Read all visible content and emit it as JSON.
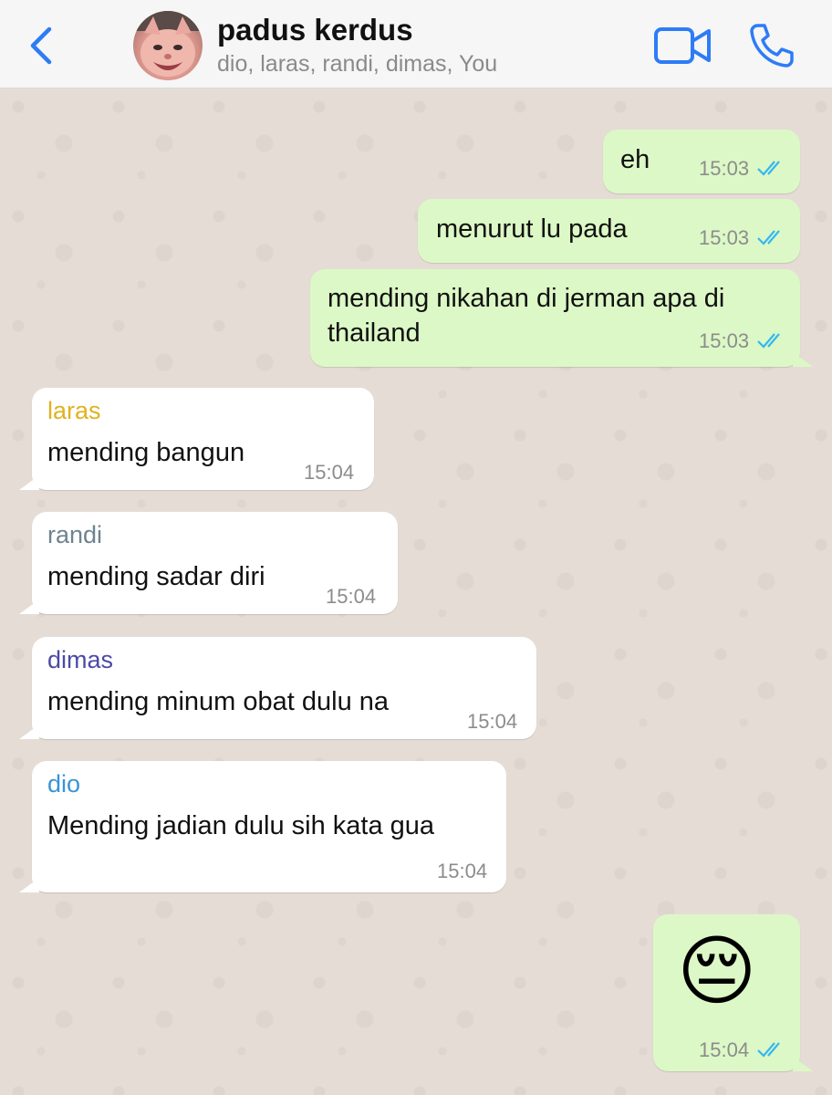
{
  "header": {
    "group_name": "padus kerdus",
    "members": "dio, laras, randi, dimas, You"
  },
  "colors": {
    "accent": "#2d7cf6",
    "outgoing_bubble": "#dcf8c6",
    "incoming_bubble": "#ffffff",
    "read_ticks": "#34b7f1",
    "sender_laras": "#e0b21e",
    "sender_randi": "#6e8390",
    "sender_dimas": "#4a4aa8",
    "sender_dio": "#3a93d6"
  },
  "messages": [
    {
      "direction": "out",
      "text": "eh",
      "time": "15:03",
      "status": "read"
    },
    {
      "direction": "out",
      "text": "menurut lu pada",
      "time": "15:03",
      "status": "read"
    },
    {
      "direction": "out",
      "text_line1": "mending nikahan di jerman apa di",
      "text_line2": "thailand",
      "time": "15:03",
      "status": "read"
    },
    {
      "direction": "in",
      "sender": "laras",
      "text": "mending bangun",
      "time": "15:04"
    },
    {
      "direction": "in",
      "sender": "randi",
      "text": "mending sadar diri",
      "time": "15:04"
    },
    {
      "direction": "in",
      "sender": "dimas",
      "text": "mending minum obat dulu na",
      "time": "15:04"
    },
    {
      "direction": "in",
      "sender": "dio",
      "text": "Mending jadian dulu sih kata gua",
      "time": "15:04"
    },
    {
      "direction": "out",
      "emoji": "😔",
      "time": "15:04",
      "status": "read"
    }
  ]
}
